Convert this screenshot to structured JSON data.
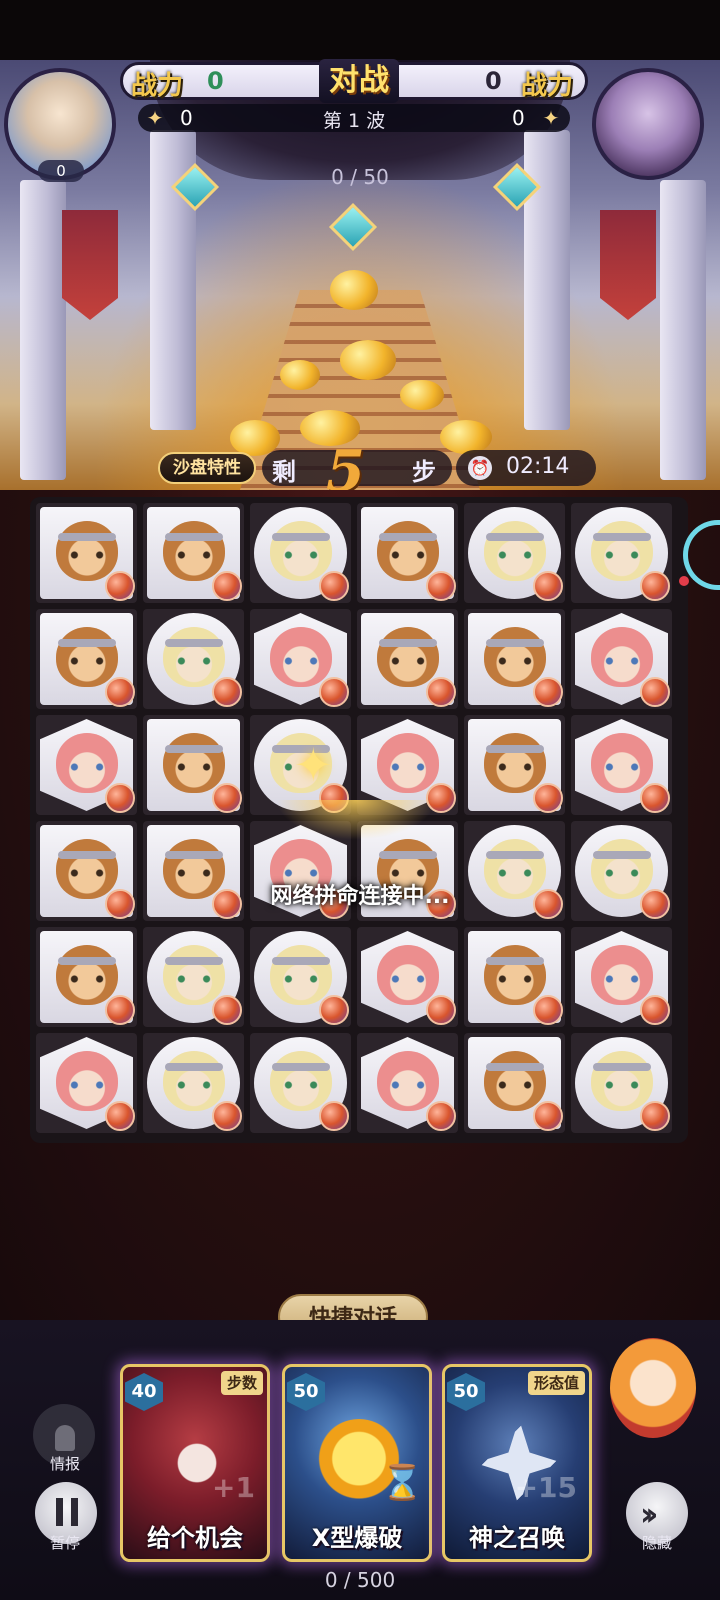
{
  "header": {
    "left_power_label": "战力",
    "left_power_value": "0",
    "vs_title": "对战",
    "right_power_value": "0",
    "right_power_label": "战力",
    "left_star_value": "0",
    "wave_title": "第 1 波",
    "right_star_value": "0",
    "wave_progress": "0 / 50",
    "left_avatar_count": "0"
  },
  "steps": {
    "sandbox_label": "沙盘特性",
    "left_label": "剩",
    "count": "5",
    "unit_label": "步",
    "timer": "02:14"
  },
  "board": {
    "rows": 6,
    "columns": 6,
    "tiles": [
      [
        "monkey",
        "monkey",
        "fox",
        "monkey",
        "fox",
        "fox"
      ],
      [
        "monkey",
        "fox",
        "girl",
        "monkey",
        "monkey",
        "girl"
      ],
      [
        "girl",
        "monkey",
        "fox",
        "girl",
        "monkey",
        "girl"
      ],
      [
        "monkey",
        "monkey",
        "girl",
        "monkey",
        "fox",
        "fox"
      ],
      [
        "monkey",
        "fox",
        "fox",
        "girl",
        "monkey",
        "girl"
      ],
      [
        "girl",
        "fox",
        "fox",
        "girl",
        "monkey",
        "fox"
      ]
    ],
    "connecting_text": "网络拼命连接中..."
  },
  "quick_chat_label": "快捷对话",
  "controls": {
    "intel_label": "情报",
    "pause_label": "暂停",
    "hide_label": "隐藏"
  },
  "cards": [
    {
      "cost": "40",
      "tag": "步数",
      "name": "给个机会",
      "bonus": "+1"
    },
    {
      "cost": "50",
      "tag": "",
      "name": "X型爆破",
      "bonus": ""
    },
    {
      "cost": "50",
      "tag": "形态值",
      "name": "神之召唤",
      "bonus": "+15"
    }
  ],
  "energy_text": "0 / 500",
  "colors": {
    "gold": "#f4c84d",
    "power_green": "#2f8f5a",
    "card_border": "#e7c766",
    "cost_blue": "#2b6f9e"
  }
}
